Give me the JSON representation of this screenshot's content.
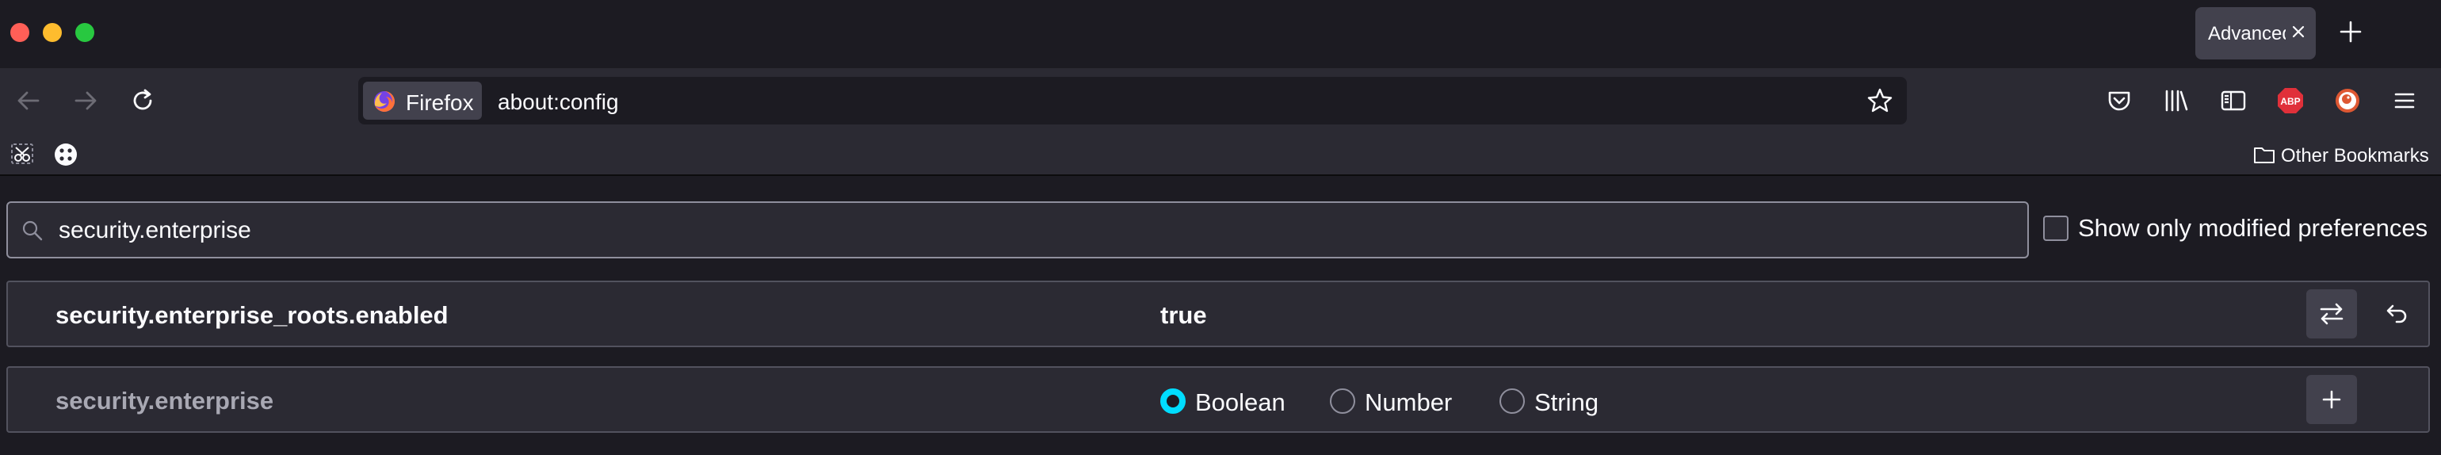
{
  "tab": {
    "title": "Advanced Preferences"
  },
  "urlbar": {
    "identity_label": "Firefox",
    "url": "about:config"
  },
  "bookmarks": {
    "other_label": "Other Bookmarks"
  },
  "search": {
    "value": "security.enterprise"
  },
  "filter": {
    "modified_only_label": "Show only modified preferences",
    "checked": false
  },
  "prefs": [
    {
      "name": "security.enterprise_roots.enabled",
      "value": "true"
    }
  ],
  "new_pref": {
    "name": "security.enterprise",
    "types": [
      {
        "label": "Boolean",
        "checked": true
      },
      {
        "label": "Number",
        "checked": false
      },
      {
        "label": "String",
        "checked": false
      }
    ]
  },
  "icons": {
    "back": "arrow-left-icon",
    "forward": "arrow-right-icon",
    "reload": "reload-icon",
    "star": "star-icon",
    "pocket": "pocket-icon",
    "library": "library-icon",
    "sidebar": "sidebar-icon",
    "abp": "adblock-plus-icon",
    "duckduckgo": "duckduckgo-icon",
    "menu": "hamburger-menu-icon",
    "toggle": "toggle-swap-icon",
    "reset": "undo-icon",
    "add": "plus-icon"
  },
  "colors": {
    "accent": "#00ddff",
    "abp": "#e0303a",
    "ddg": "#de5833"
  }
}
